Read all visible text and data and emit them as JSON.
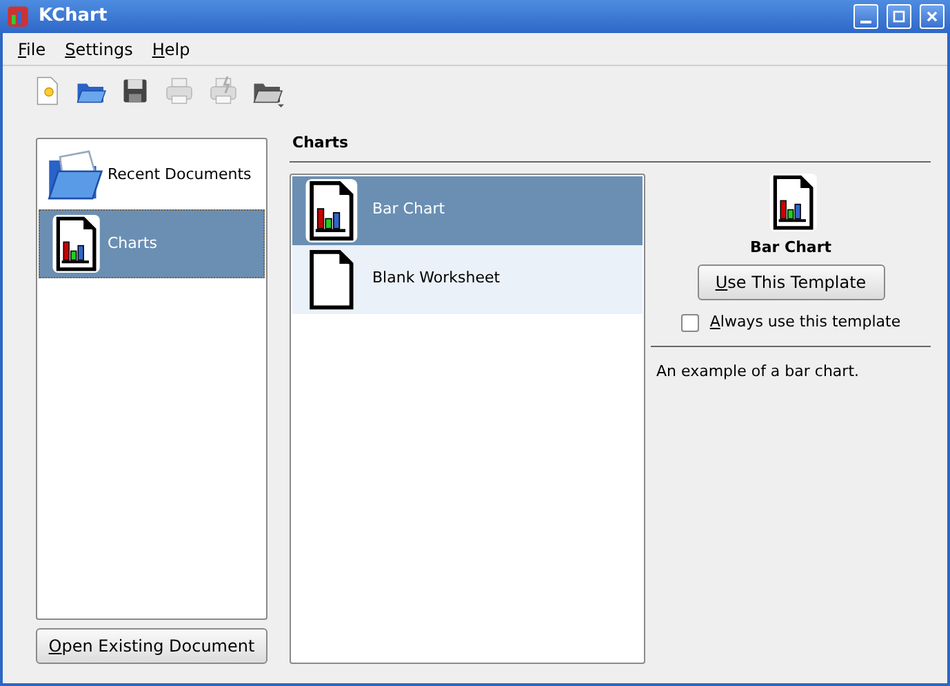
{
  "window": {
    "title": "KChart"
  },
  "menu": [
    "File",
    "Settings",
    "Help"
  ],
  "toolbar": [
    {
      "kind": "new",
      "disabled": false
    },
    {
      "kind": "open",
      "disabled": false
    },
    {
      "kind": "save",
      "disabled": false
    },
    {
      "kind": "print",
      "disabled": true
    },
    {
      "kind": "preview",
      "disabled": true
    },
    {
      "kind": "open-menu",
      "disabled": false
    }
  ],
  "categories": [
    {
      "kind": "folder",
      "label": "Recent Documents",
      "selected": false
    },
    {
      "kind": "chart",
      "label": "Charts",
      "selected": true
    }
  ],
  "open_button": "Open Existing Document",
  "section_title": "Charts",
  "templates": [
    {
      "kind": "chart",
      "label": "Bar Chart",
      "selected": true
    },
    {
      "kind": "blank",
      "label": "Blank Worksheet",
      "selected": false
    }
  ],
  "preview": {
    "kind": "chart",
    "title": "Bar Chart",
    "button": "Use This Template",
    "always_label": "Always use this template",
    "always_checked": false,
    "description": "An example of a bar chart."
  }
}
